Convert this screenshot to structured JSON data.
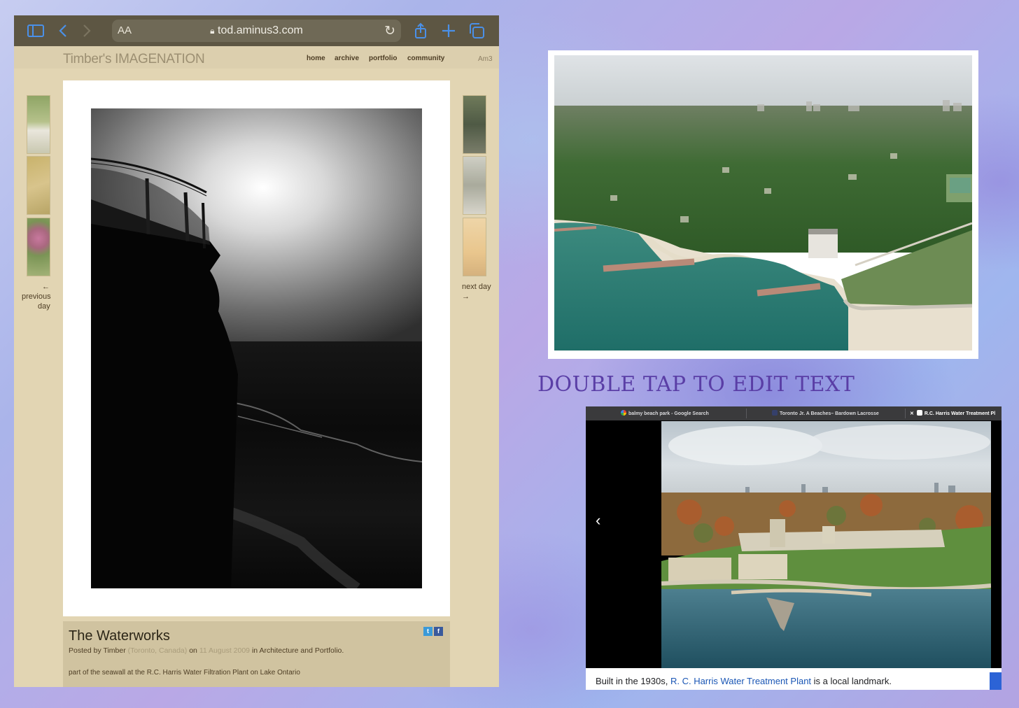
{
  "safari": {
    "url": "tod.aminus3.com",
    "text_size_label": "AA",
    "icons": [
      "sidebar-icon",
      "back-icon",
      "forward-icon",
      "reload-icon",
      "share-icon",
      "new-tab-icon",
      "tabs-icon"
    ]
  },
  "site": {
    "title": "Timber's IMAGENATION",
    "nav": [
      "home",
      "archive",
      "portfolio",
      "community"
    ],
    "brand": "Am3",
    "previous_arrow": "←",
    "previous_label_1": "previous",
    "previous_label_2": "day",
    "next_label": "next day",
    "next_arrow": "→"
  },
  "post": {
    "title": "The Waterworks",
    "posted_by": "Posted by",
    "author": "Timber",
    "location": "(Toronto, Canada)",
    "on": "on",
    "date": "11 August 2009",
    "in": "in",
    "category1": "Architecture",
    "and": "and",
    "category2": "Portfolio",
    "period": ".",
    "description": "part of the seawall at the R.C. Harris Water Filtration Plant on Lake Ontario",
    "share_twitter": "t",
    "share_facebook": "f"
  },
  "overlay_text": "DOUBLE TAP TO EDIT TEXT",
  "browser2": {
    "tabs": [
      {
        "label": "balmy beach park - Google Search",
        "icon": "google-icon"
      },
      {
        "label": "Toronto Jr. A Beaches– Bardown Lacrosse",
        "icon": "yahoo-icon"
      },
      {
        "label": "R.C. Harris Water Treatment Pl",
        "icon": "wikipedia-icon"
      }
    ],
    "close_glyph": "✕",
    "prev_glyph": "‹",
    "caption_pre": "Built in the 1930s, ",
    "caption_link": "R. C. Harris Water Treatment Plant",
    "caption_post": " is a local landmark."
  },
  "colors": {
    "safari_toolbar": "#5d5643",
    "safari_accent": "#4a90e8",
    "page_bg": "#e2d5b3",
    "edit_text": "#5a3ea6",
    "link_blue": "#1a56b5"
  }
}
